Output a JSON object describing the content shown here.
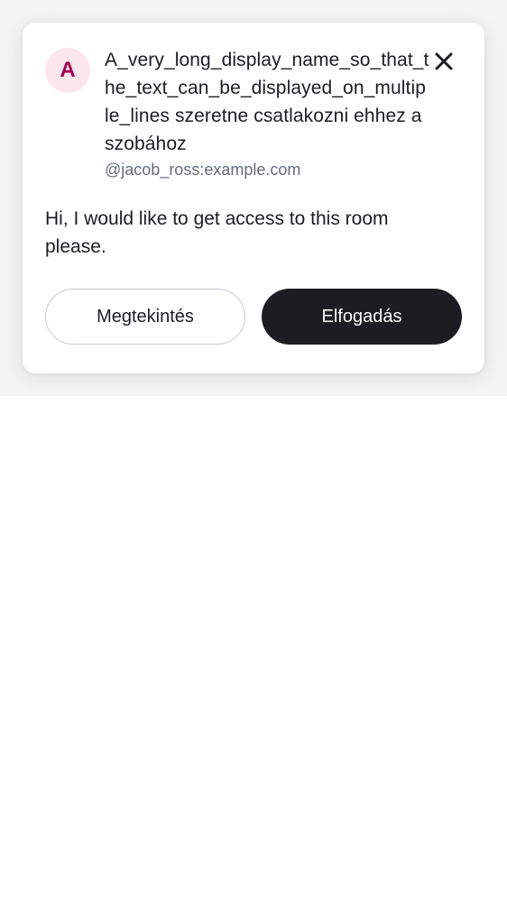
{
  "invite": {
    "avatar_letter": "A",
    "title": "A_very_long_display_name_so_that_the_text_can_be_displayed_on_multiple_lines szeretne csatlakozni ehhez a szobához",
    "user_id": "@jacob_ross:example.com",
    "message": "Hi, I would like to get access to this room please.",
    "close_icon": "close-icon",
    "view_label": "Megtekintés",
    "accept_label": "Elfogadás"
  },
  "colors": {
    "avatar_bg": "#fde6ee",
    "avatar_fg": "#a1004e",
    "primary_button": "#1b1d22",
    "text_primary": "#1b1d22",
    "text_secondary": "#656d77"
  }
}
